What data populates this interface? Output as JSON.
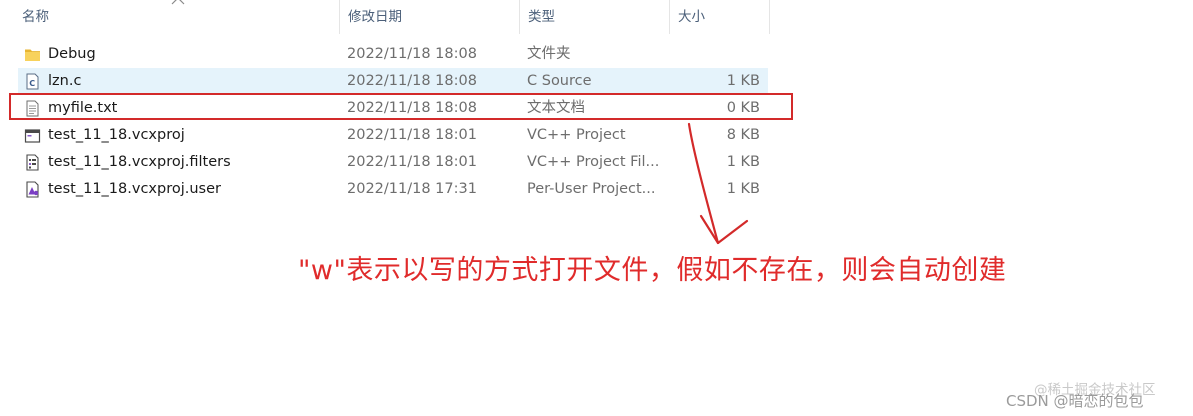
{
  "columns": {
    "name": "名称",
    "date": "修改日期",
    "type": "类型",
    "size": "大小"
  },
  "files": [
    {
      "icon": "folder-icon",
      "name": "Debug",
      "date": "2022/11/18 18:08",
      "type": "文件夹",
      "size": ""
    },
    {
      "icon": "c-source-icon",
      "name": "lzn.c",
      "date": "2022/11/18 18:08",
      "type": "C Source",
      "size": "1 KB"
    },
    {
      "icon": "text-file-icon",
      "name": "myfile.txt",
      "date": "2022/11/18 18:08",
      "type": "文本文档",
      "size": "0 KB"
    },
    {
      "icon": "vcxproj-icon",
      "name": "test_11_18.vcxproj",
      "date": "2022/11/18 18:01",
      "type": "VC++ Project",
      "size": "8 KB"
    },
    {
      "icon": "filters-icon",
      "name": "test_11_18.vcxproj.filters",
      "date": "2022/11/18 18:01",
      "type": "VC++ Project Fil...",
      "size": "1 KB"
    },
    {
      "icon": "user-file-icon",
      "name": "test_11_18.vcxproj.user",
      "date": "2022/11/18 17:31",
      "type": "Per-User Project...",
      "size": "1 KB"
    }
  ],
  "annotation": {
    "text": "\"w\"表示以写的方式打开文件，假如不存在，则会自动创建",
    "color": "#e02b2b"
  },
  "watermark": {
    "line1": "@稀土掘金技术社区",
    "line2": "CSDN @暗恋的包包"
  }
}
